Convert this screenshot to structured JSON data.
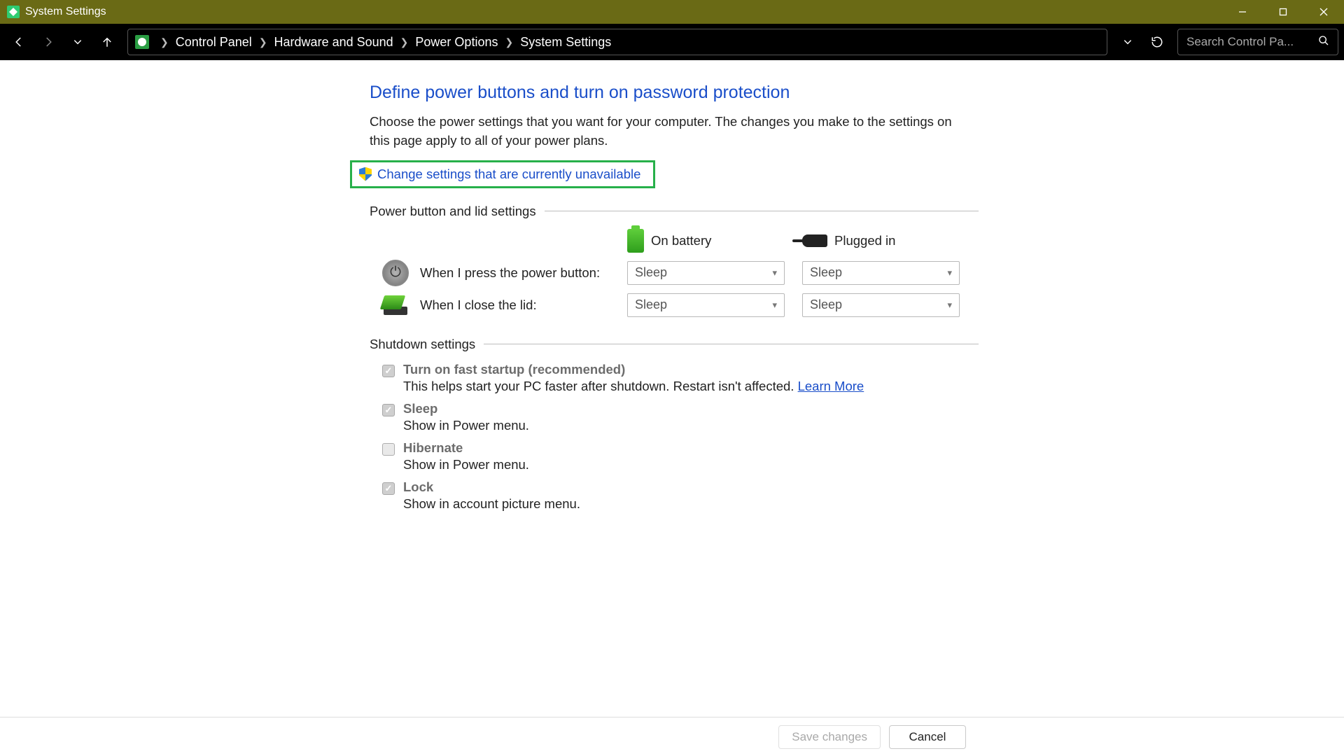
{
  "window": {
    "title": "System Settings"
  },
  "breadcrumb": {
    "items": [
      "Control Panel",
      "Hardware and Sound",
      "Power Options",
      "System Settings"
    ]
  },
  "search": {
    "placeholder": "Search Control Pa..."
  },
  "page": {
    "title": "Define power buttons and turn on password protection",
    "description": "Choose the power settings that you want for your computer. The changes you make to the settings on this page apply to all of your power plans.",
    "uac_link": "Change settings that are currently unavailable"
  },
  "section1": {
    "header": "Power button and lid settings",
    "col_battery": "On battery",
    "col_plugged": "Plugged in",
    "row_power_button": "When I press the power button:",
    "row_lid": "When I close the lid:",
    "power_button_battery": "Sleep",
    "power_button_plugged": "Sleep",
    "lid_battery": "Sleep",
    "lid_plugged": "Sleep"
  },
  "section2": {
    "header": "Shutdown settings",
    "items": [
      {
        "title": "Turn on fast startup (recommended)",
        "sub": "This helps start your PC faster after shutdown. Restart isn't affected. ",
        "link": "Learn More",
        "checked": true
      },
      {
        "title": "Sleep",
        "sub": "Show in Power menu.",
        "checked": true
      },
      {
        "title": "Hibernate",
        "sub": "Show in Power menu.",
        "checked": false
      },
      {
        "title": "Lock",
        "sub": "Show in account picture menu.",
        "checked": true
      }
    ]
  },
  "footer": {
    "save": "Save changes",
    "cancel": "Cancel"
  }
}
